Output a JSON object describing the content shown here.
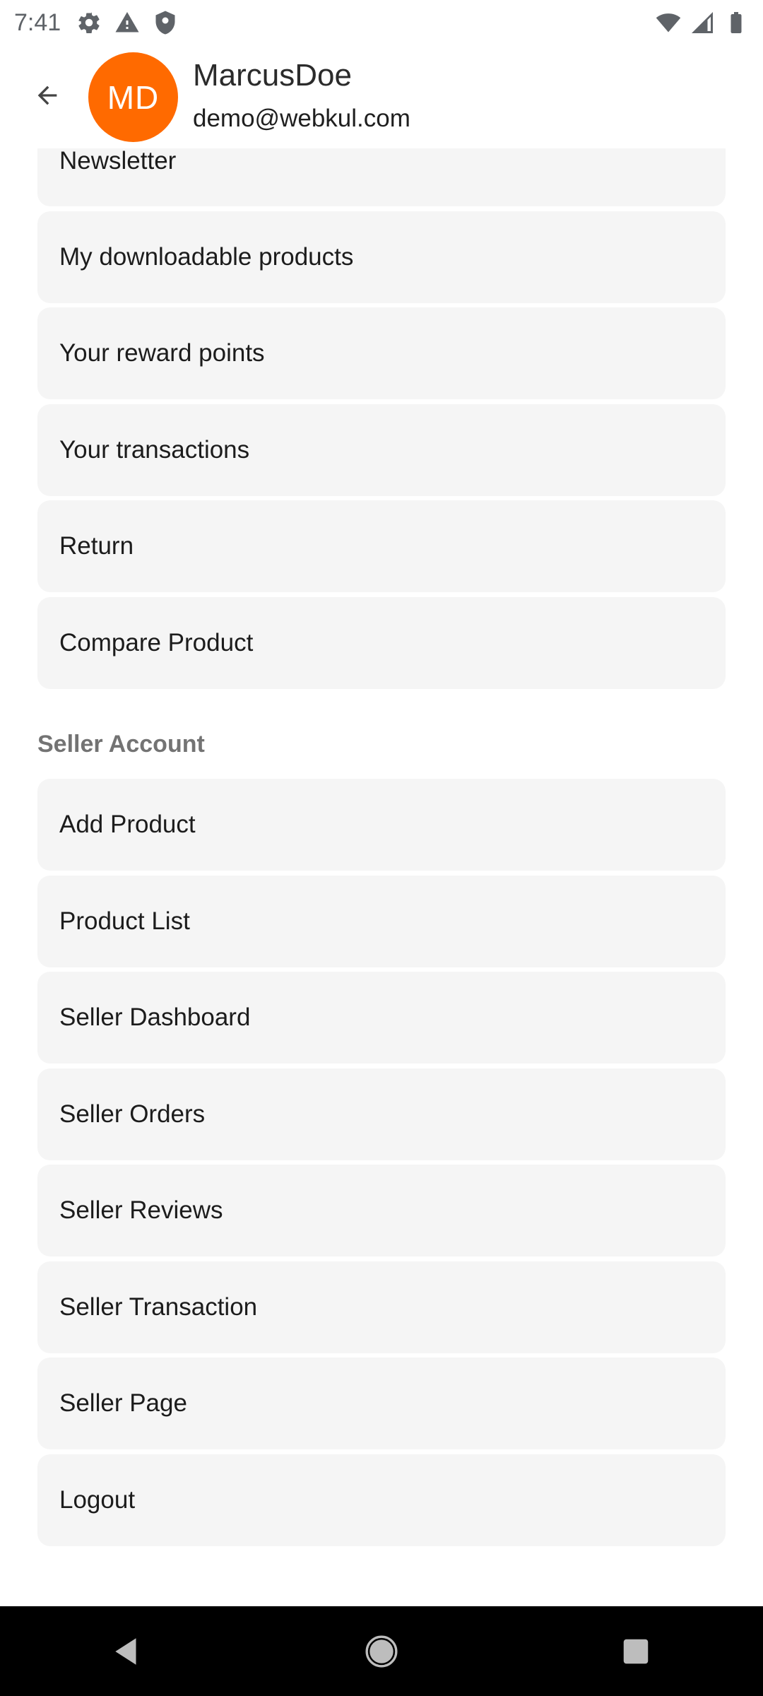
{
  "status_bar": {
    "time": "7:41",
    "left_icons": [
      "settings-icon",
      "warning-icon",
      "shield-icon"
    ],
    "right_icons": [
      "wifi-icon",
      "signal-icon",
      "battery-icon"
    ]
  },
  "header": {
    "avatar_initials": "MD",
    "avatar_color": "#ff6a00",
    "name": "MarcusDoe",
    "email": "demo@webkul.com"
  },
  "account_items": [
    {
      "label": "Newsletter"
    },
    {
      "label": "My downloadable products"
    },
    {
      "label": "Your reward points"
    },
    {
      "label": "Your transactions"
    },
    {
      "label": "Return"
    },
    {
      "label": "Compare Product"
    }
  ],
  "seller_section": {
    "title": "Seller Account",
    "items": [
      {
        "label": "Add Product"
      },
      {
        "label": "Product List"
      },
      {
        "label": "Seller Dashboard"
      },
      {
        "label": "Seller Orders"
      },
      {
        "label": "Seller Reviews"
      },
      {
        "label": "Seller Transaction"
      },
      {
        "label": "Seller Page"
      },
      {
        "label": "Logout"
      }
    ]
  },
  "nav_bar": {
    "buttons": [
      "back-icon",
      "home-icon",
      "recents-icon"
    ]
  }
}
